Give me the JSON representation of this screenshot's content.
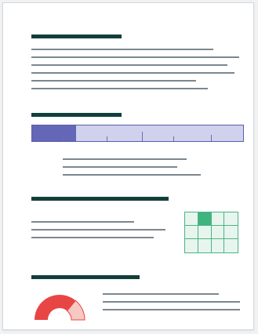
{
  "colors": {
    "heading": "#123f3a",
    "text_line": "#7b878f",
    "progress_fill": "#6467b7",
    "progress_track": "#cfd1ed",
    "grid_accent": "#3fb47f",
    "gauge_fill": "#e84545",
    "gauge_rest": "#f6c9c2"
  },
  "progress": {
    "value_fraction": 0.21,
    "tick_count": 5
  },
  "grid_widget": {
    "rows": 3,
    "cols": 4,
    "highlighted_cell": [
      0,
      1
    ]
  },
  "gauge": {
    "value_fraction": 0.72
  }
}
